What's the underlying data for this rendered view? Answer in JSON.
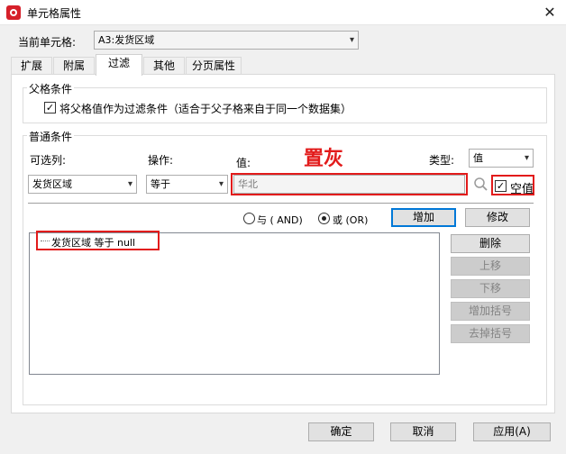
{
  "window": {
    "title": "单元格属性",
    "close_glyph": "✕"
  },
  "current_cell": {
    "label": "当前单元格:",
    "value": "A3:发货区域"
  },
  "tabs": [
    {
      "label": "扩展",
      "active": false
    },
    {
      "label": "附属",
      "active": false
    },
    {
      "label": "过滤",
      "active": true
    },
    {
      "label": "其他",
      "active": false
    },
    {
      "label": "分页属性",
      "active": false
    }
  ],
  "parent_condition": {
    "title": "父格条件",
    "checkbox_label": "将父格值作为过滤条件（适合于父子格来自于同一个数据集）",
    "checked": true
  },
  "normal_condition": {
    "title": "普通条件",
    "optional_column_label": "可选列:",
    "operation_label": "操作:",
    "value_label": "值:",
    "type_label": "类型:",
    "annotation": "置灰",
    "annotation_color": "#e21b1b",
    "column_value": "发货区域",
    "operation_value": "等于",
    "value_value": "华北",
    "type_value": "值",
    "null_checkbox_label": "空值",
    "null_checked": true,
    "search_icon": "search-icon"
  },
  "logic": {
    "and_label": "与 ( AND)",
    "or_label": "或 (OR)",
    "selected": "or"
  },
  "buttons": {
    "add": "增加",
    "modify": "修改",
    "delete": "删除",
    "move_up": "上移",
    "move_down": "下移",
    "add_bracket": "增加括号",
    "remove_bracket": "去掉括号"
  },
  "conditions_list": [
    "发货区域 等于 null"
  ],
  "footer": {
    "ok": "确定",
    "cancel": "取消",
    "apply": "应用(A)"
  },
  "colors": {
    "accent_red": "#e21b1b",
    "focus_blue": "#0078d7"
  }
}
